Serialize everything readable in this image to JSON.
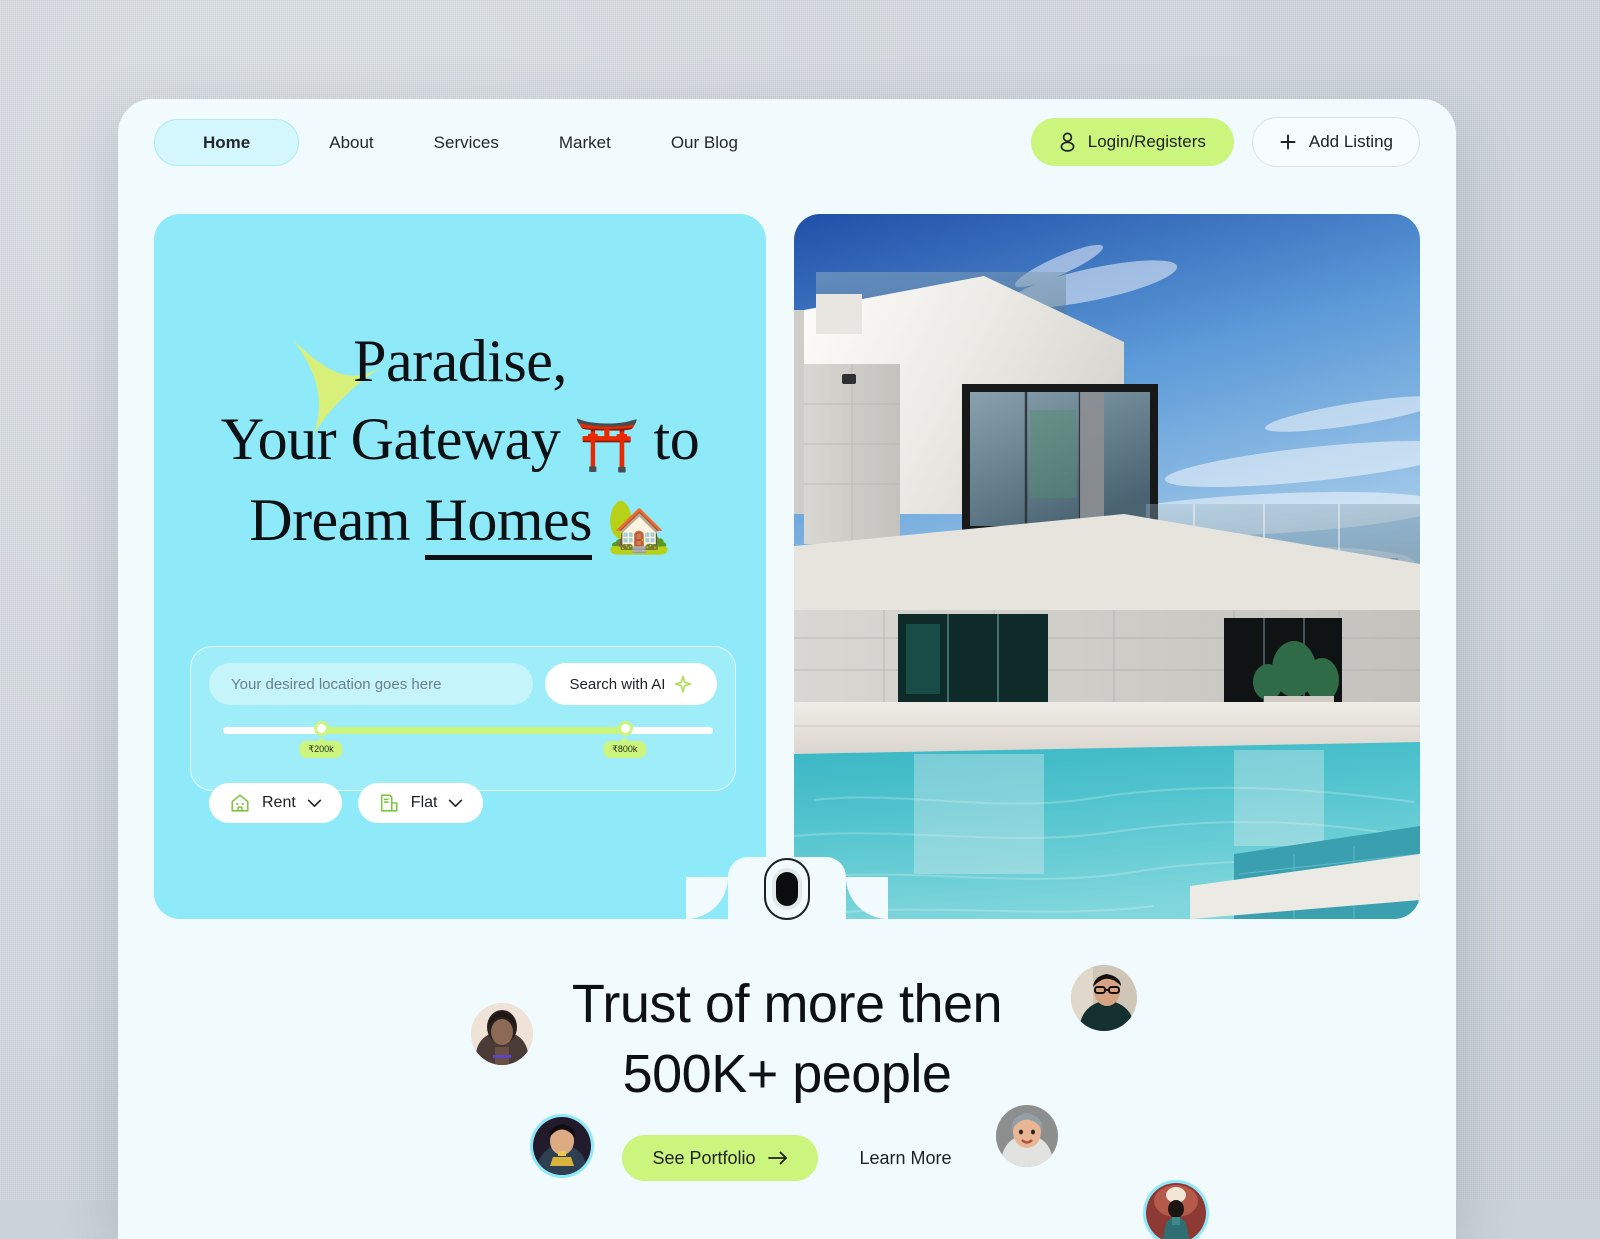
{
  "nav": {
    "links": [
      {
        "label": "Home",
        "active": true
      },
      {
        "label": "About",
        "active": false
      },
      {
        "label": "Services",
        "active": false
      },
      {
        "label": "Market",
        "active": false
      },
      {
        "label": "Our Blog",
        "active": false
      }
    ],
    "login_label": "Login/Registers",
    "login_icon": "user-icon",
    "add_listing_label": "Add Listing",
    "add_listing_icon": "plus-icon"
  },
  "hero": {
    "headline": {
      "line1": "Paradise,",
      "line2_a": "Your Gateway",
      "line2_emoji": "⛩️",
      "line2_b": "to",
      "line3_a": "Dream",
      "line3_underlined": "Homes",
      "line3_emoji": "🏡"
    },
    "search": {
      "placeholder": "Your desired location goes here",
      "value": "",
      "ai_button_label": "Search with AI",
      "ai_button_icon": "sparkle-icon",
      "price_min_label": "₹200k",
      "price_max_label": "₹800k",
      "filters": [
        {
          "label": "Rent",
          "icon": "house-icon"
        },
        {
          "label": "Flat",
          "icon": "building-icon"
        }
      ]
    },
    "image_alt": "modern white villa with swimming pool",
    "notch_icon": "camera-icon"
  },
  "trust": {
    "title_line1": "Trust of more then",
    "title_line2": "500K+ people",
    "portfolio_label": "See Portfolio",
    "portfolio_icon": "arrow-right-icon",
    "learn_more_label": "Learn More",
    "avatar_count": 5
  },
  "colors": {
    "accent_green": "#ccf57e",
    "hero_cyan": "#8eeaf9",
    "card_bg": "#f1fafd",
    "page_bg": "#ccd2d9",
    "nav_active_bg": "#d4f7fd",
    "text": "#0d1113"
  }
}
